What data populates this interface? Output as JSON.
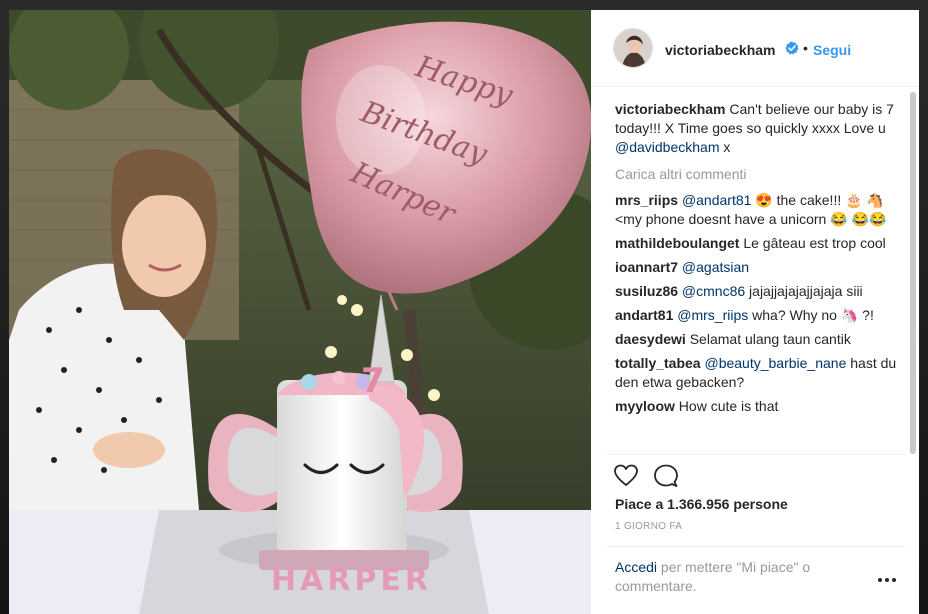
{
  "post": {
    "username": "victoriabeckham",
    "dot": "•",
    "follow_label": "Segui",
    "caption": {
      "username": "victoriabeckham",
      "text": "Can't believe our baby is 7 today!!! X Time goes so quickly xxxx Love u ",
      "mention": "@davidbeckham",
      "suffix": " x"
    },
    "load_more_label": "Carica altri commenti",
    "comments": [
      {
        "user": "mrs_riips",
        "mention": "@andart81",
        "text": " 😍 the cake!!! 🎂 🐴 <my phone doesnt have a unicorn 😂 😂😂"
      },
      {
        "user": "mathildeboulanget",
        "mention": "",
        "text": "Le gâteau est trop cool"
      },
      {
        "user": "ioannart7",
        "mention": "@agatsian",
        "text": ""
      },
      {
        "user": "susiluz86",
        "mention": "@cmnc86",
        "text": " jajajjajajajjajaja siii"
      },
      {
        "user": "andart81",
        "mention": "@mrs_riips",
        "text": " wha? Why no 🦄 ?!"
      },
      {
        "user": "daesydewi",
        "mention": "",
        "text": "Selamat ulang taun cantik"
      },
      {
        "user": "totally_tabea",
        "mention": "@beauty_barbie_nane",
        "text": " hast du den etwa gebacken?"
      },
      {
        "user": "myyloow",
        "mention": "",
        "text": "How cute is that"
      }
    ],
    "likes_text": "Piace a 1.366.956 persone",
    "date": "1 GIORNO FA",
    "login_link": "Accedi",
    "login_rest": " per mettere \"Mi piace\" o commentare.",
    "icons": {
      "like": "heart-icon",
      "comment": "comment-icon",
      "more": "more-options-icon",
      "verified": "verified-badge-icon"
    },
    "colors": {
      "accent": "#3897f0",
      "link": "#003569",
      "muted": "#999999",
      "text": "#262626"
    }
  },
  "photo": {
    "balloon_text": [
      "Happy",
      "Birthday",
      "Harper"
    ],
    "cake_number": "7",
    "cake_name": "HARPER"
  }
}
